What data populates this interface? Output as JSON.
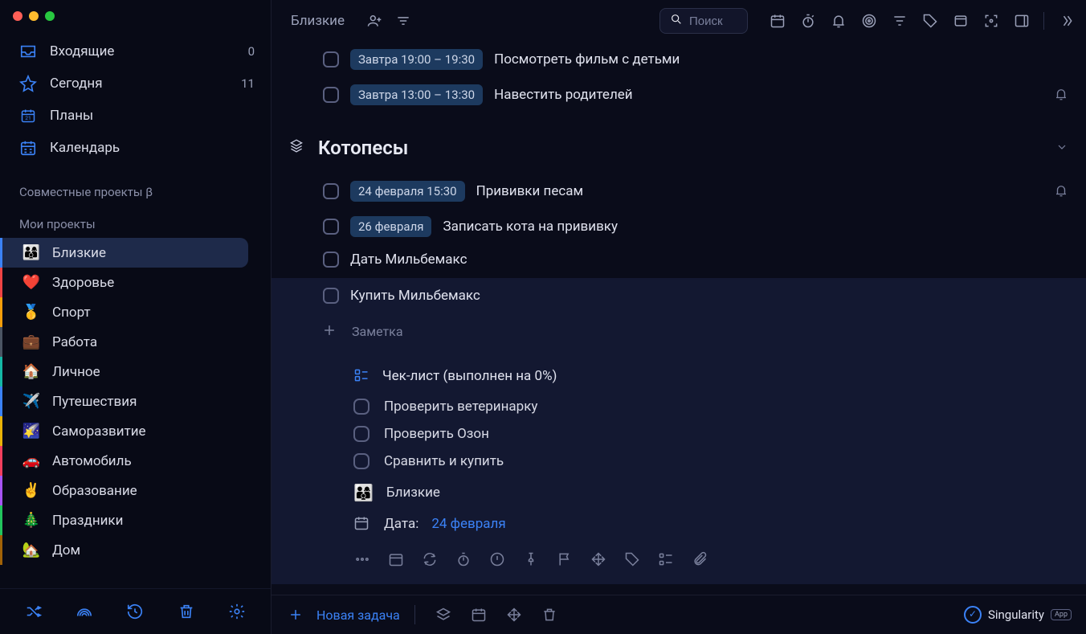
{
  "app": {
    "brand": "Singularity",
    "brand_chip": "App"
  },
  "sidebar": {
    "nav": {
      "inbox": {
        "label": "Входящие",
        "count": "0"
      },
      "today": {
        "label": "Сегодня",
        "count": "11"
      },
      "plans": {
        "label": "Планы"
      },
      "calendar": {
        "label": "Календарь"
      }
    },
    "shared_header": "Совместные проекты β",
    "my_projects_header": "Мои проекты",
    "projects": [
      {
        "emoji": "👨‍👩‍👦",
        "label": "Близкие"
      },
      {
        "emoji": "❤️",
        "label": "Здоровье"
      },
      {
        "emoji": "🥇",
        "label": "Спорт"
      },
      {
        "emoji": "💼",
        "label": "Работа"
      },
      {
        "emoji": "🏠",
        "label": "Личное"
      },
      {
        "emoji": "✈️",
        "label": "Путешествия"
      },
      {
        "emoji": "🌠",
        "label": "Саморазвитие"
      },
      {
        "emoji": "🚗",
        "label": "Автомобиль"
      },
      {
        "emoji": "✌️",
        "label": "Образование"
      },
      {
        "emoji": "🎄",
        "label": "Праздники"
      },
      {
        "emoji": "🏡",
        "label": "Дом"
      }
    ]
  },
  "header": {
    "title": "Близкие",
    "search_placeholder": "Поиск"
  },
  "content": {
    "top_tasks": [
      {
        "date": "Завтра 19:00 – 19:30",
        "title": "Посмотреть фильм с детьми",
        "bell": false
      },
      {
        "date": "Завтра 13:00 – 13:30",
        "title": "Навестить родителей",
        "bell": true
      }
    ],
    "section": {
      "title": "Котопесы"
    },
    "section_tasks": [
      {
        "date": "24 февраля 15:30",
        "title": "Прививки песам",
        "bell": true
      },
      {
        "date": "26 февраля",
        "title": "Записать кота на прививку",
        "bell": false
      },
      {
        "date": "",
        "title": "Дать Мильбемакс",
        "bell": false
      }
    ],
    "expanded": {
      "title": "Купить Мильбемакс",
      "note_placeholder": "Заметка",
      "checklist_header": "Чек-лист (выполнен на 0%)",
      "checklist": [
        "Проверить ветеринарку",
        "Проверить Озон",
        "Сравнить и купить"
      ],
      "project": "Близкие",
      "project_emoji": "👨‍👩‍👦",
      "date_label": "Дата:",
      "date_value": "24 февраля"
    }
  },
  "footer": {
    "new_task": "Новая задача"
  }
}
